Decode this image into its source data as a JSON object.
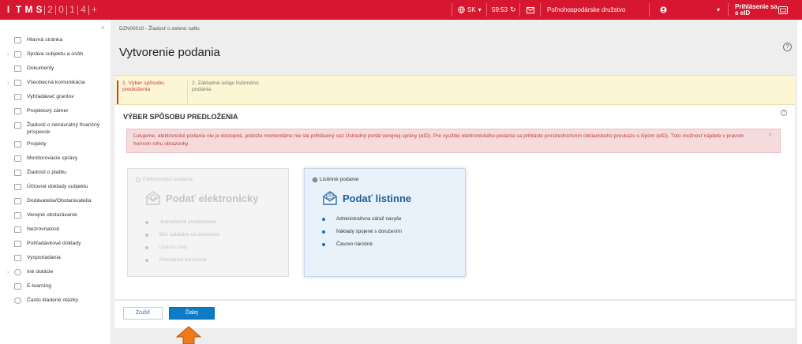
{
  "topbar": {
    "logo_cells": [
      "I",
      "T",
      "M",
      "S",
      "2",
      "0",
      "1",
      "4",
      "+"
    ],
    "lang": "SK",
    "timer": "59:53",
    "organization": "Poľnohospodárske družstvo",
    "login_line1": "Prihlásenie sa",
    "login_line2": "s eID",
    "bg_color": "#d7172f"
  },
  "breadcrumb": "DZN00010 - Žiadosť o zelenú naftu",
  "page_title": "Vytvorenie podania",
  "sidebar": {
    "items": [
      {
        "label": "Hlavná stránka",
        "icon": "home-icon",
        "arrow": ""
      },
      {
        "label": "Správa subjektu a osôb",
        "icon": "users-icon",
        "arrow": "›"
      },
      {
        "label": "Dokumenty",
        "icon": "documents-icon",
        "arrow": ""
      },
      {
        "label": "Všeobecná komunikácia",
        "icon": "mail-icon",
        "arrow": "›"
      },
      {
        "label": "Vyhľadávač grantov",
        "icon": "search-grants-icon",
        "arrow": ""
      },
      {
        "label": "Projektový zámer",
        "icon": "project-plan-icon",
        "arrow": ""
      },
      {
        "label": "Žiadosti o nenávratný finančný príspevok",
        "icon": "grant-request-icon",
        "arrow": ""
      },
      {
        "label": "Projekty",
        "icon": "projects-icon",
        "arrow": ""
      },
      {
        "label": "Monitorovacie správy",
        "icon": "monitoring-icon",
        "arrow": ""
      },
      {
        "label": "Žiadosti o platbu",
        "icon": "payment-icon",
        "arrow": ""
      },
      {
        "label": "Účtovné doklady subjektu",
        "icon": "accounting-icon",
        "arrow": ""
      },
      {
        "label": "Dodávatelia/Obstarávatelia",
        "icon": "suppliers-icon",
        "arrow": ""
      },
      {
        "label": "Verejné obstarávanie",
        "icon": "procurement-icon",
        "arrow": ""
      },
      {
        "label": "Nezrovnalosti",
        "icon": "irregularities-icon",
        "arrow": ""
      },
      {
        "label": "Pohľadávkové doklady",
        "icon": "receivables-icon",
        "arrow": ""
      },
      {
        "label": "Vysporiadania",
        "icon": "settlements-icon",
        "arrow": ""
      },
      {
        "label": "Iné dotácie",
        "icon": "other-subsidies-icon",
        "arrow": "›"
      },
      {
        "label": "E-learning",
        "icon": "elearning-icon",
        "arrow": ""
      },
      {
        "label": "Často kladené otázky",
        "icon": "faq-icon",
        "arrow": ""
      }
    ]
  },
  "steps": [
    {
      "label": "1. Výber spôsobu predloženia"
    },
    {
      "label": "2. Základné údaje listinného podania"
    }
  ],
  "section": {
    "title": "VÝBER SPÔSOBU PREDLOŽENIA",
    "alert": "Ľutujeme, elektronické podanie nie je dostupné, pretože momentálne nie ste prihlásený cez Ústredný portál verejnej správy (eID). Pre využitie elektronického podania sa prihláste prostredníctvom občianskeho preukazu s čipom (eID). Túto možnosť nájdete v pravom hornom rohu obrazovky."
  },
  "options": {
    "electronic": {
      "radio_label": "Elektronické podanie",
      "title": "Podať elektronicky",
      "bullets": [
        "Jednoduché predkladanie",
        "Bez nákladov na doručenie",
        "Úspora času",
        "Potvrdenie doručenia"
      ]
    },
    "paper": {
      "radio_label": "Listinné podanie",
      "title": "Podať listinne",
      "bullets": [
        "Administratívna záťaž navyše",
        "Náklady spojené s doručením",
        "Časovo náročné"
      ]
    }
  },
  "buttons": {
    "cancel": "Zrušiť",
    "next": "Ďalej"
  },
  "colors": {
    "accent": "#0e7bc6",
    "alert_text": "#c23b3b",
    "step_active": "#c83c3c",
    "annotation_arrow": "#f07a1a"
  }
}
